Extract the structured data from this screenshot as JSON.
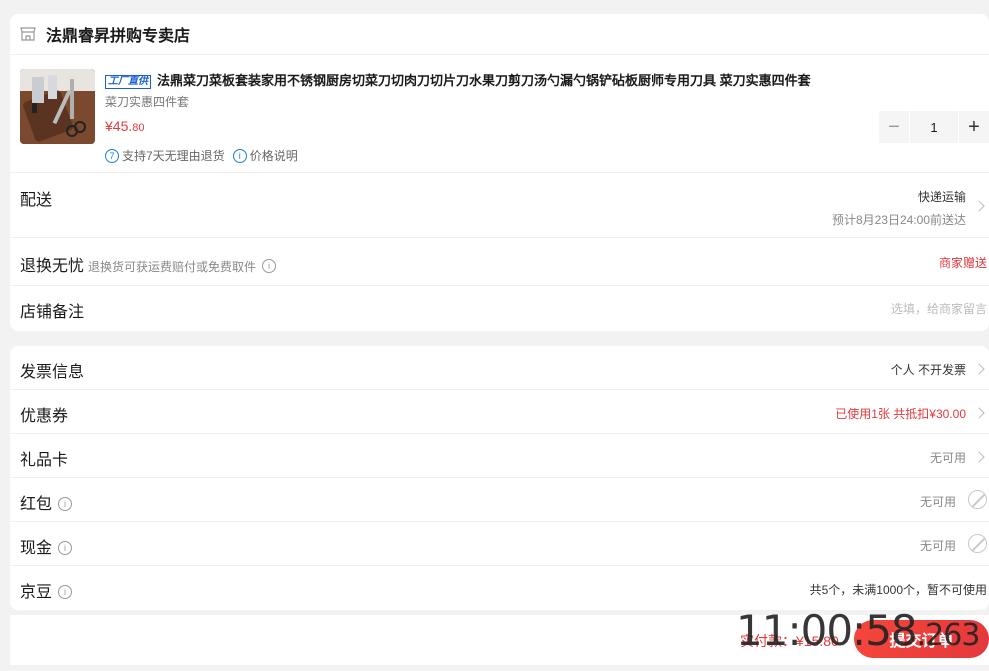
{
  "store": {
    "name": "法鼎睿昇拼购专卖店",
    "icon": "store-icon"
  },
  "product": {
    "tag": "工厂直供",
    "title": "法鼎菜刀菜板套装家用不锈钢厨房切菜刀切肉刀切片刀水果刀剪刀汤勺漏勺锅铲砧板厨师专用刀具 菜刀实惠四件套",
    "spec": "菜刀实惠四件套",
    "price_symbol": "¥",
    "price_int": "45.",
    "price_dec": "80",
    "quantity": "1",
    "service_return_num": "7",
    "service_return": "支持7天无理由退货",
    "service_price": "价格说明"
  },
  "delivery": {
    "label": "配送",
    "method": "快递运输",
    "eta": "预计8月23日24:00前送达"
  },
  "return_worry": {
    "label": "退换无忧",
    "sub": "退换货可获运费赔付或免费取件",
    "value": "商家赠送"
  },
  "remark": {
    "label": "店铺备注",
    "placeholder": "选填，给商家留言"
  },
  "invoice": {
    "label": "发票信息",
    "value": "个人 不开发票"
  },
  "coupon": {
    "label": "优惠券",
    "value": "已使用1张 共抵扣¥30.00"
  },
  "giftcard": {
    "label": "礼品卡",
    "value": "无可用"
  },
  "redpacket": {
    "label": "红包",
    "value": "无可用"
  },
  "cash": {
    "label": "现金",
    "value": "无可用"
  },
  "jingdou": {
    "label": "京豆",
    "value": "共5个，未满1000个，暂不可使用"
  },
  "footer": {
    "pay_label": "实付款：¥15.80",
    "submit": "提交订单"
  },
  "overlay_clock": {
    "time": "11:00:58",
    "ms": ".263"
  },
  "colors": {
    "accent": "#e4393c",
    "background": "#f2f2f2"
  }
}
